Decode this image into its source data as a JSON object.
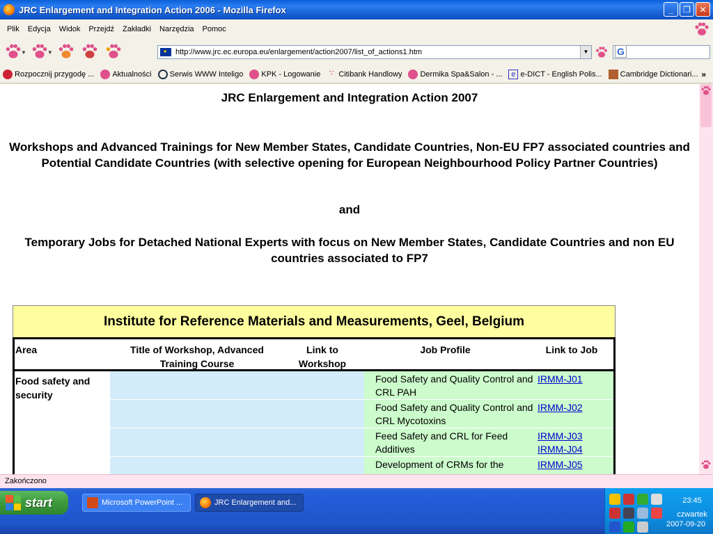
{
  "window": {
    "title": "JRC Enlargement and Integration Action 2006 - Mozilla Firefox",
    "buttons": [
      "_",
      "❐",
      "✕"
    ]
  },
  "menu": [
    "Plik",
    "Edycja",
    "Widok",
    "Przejdź",
    "Zakładki",
    "Narzędzia",
    "Pomoc"
  ],
  "address": {
    "url": "http://www.jrc.ec.europa.eu/enlargement/action2007/list_of_actions1.htm",
    "search_value": ""
  },
  "bookmarks": [
    "Rozpocznij przygodę ...",
    "Aktualności",
    "Serwis WWW Inteligo",
    "KPK - Logowanie",
    "Citibank Handlowy",
    "Dermika Spa&Salon - ...",
    "e-DICT - English Polis...",
    "Cambridge Dictionari..."
  ],
  "bookmarks_more": "»",
  "page": {
    "heading": "JRC Enlargement and Integration Action 2007",
    "sub1": "Workshops and Advanced Trainings for New Member States, Candidate Countries, Non-EU FP7 associated countries and Potential Candidate Countries (with selective opening for European Neighbourhood Policy Partner Countries)",
    "and": "and",
    "sub2": "Temporary Jobs for Detached National Experts with focus on New Member States, Candidate Countries and non EU countries associated to FP7",
    "institute": "Institute for Reference Materials and Measurements, Geel, Belgium",
    "columns": {
      "area": "Area",
      "title": "Title of Workshop, Advanced Training Course",
      "link_workshop": "Link to Workshop",
      "job_profile": "Job Profile",
      "link_job": "Link to Job"
    },
    "area": "Food safety and security",
    "rows": [
      {
        "profile": "Food Safety and Quality Control and CRL PAH",
        "jobs": [
          "IRMM-J01"
        ]
      },
      {
        "profile": "Food Safety and Quality Control and CRL Mycotoxins",
        "jobs": [
          "IRMM-J02"
        ]
      },
      {
        "profile": "Feed Safety and CRL for Feed Additives",
        "jobs": [
          "IRMM-J03",
          "IRMM-J04"
        ]
      },
      {
        "profile": "Development of CRMs for the",
        "jobs": [
          "IRMM-J05"
        ]
      }
    ]
  },
  "status": "Zakończono",
  "taskbar": {
    "start": "start",
    "tasks": [
      "Microsoft PowerPoint ...",
      "JRC Enlargement and..."
    ],
    "time": "23:45",
    "day": "czwartek",
    "date": "2007-09-20"
  },
  "colors": {
    "title_bar": "#1a62d6",
    "institute_header": "#ffffa0",
    "workshop_cell": "#d3ecf9",
    "job_cell": "#ccfbcc",
    "link": "#0000cc",
    "status_bar": "#fde3ee"
  },
  "icons": [
    "firefox-icon",
    "paw-icon",
    "eu-flag-icon",
    "google-icon",
    "windows-flag-icon",
    "powerpoint-icon"
  ]
}
